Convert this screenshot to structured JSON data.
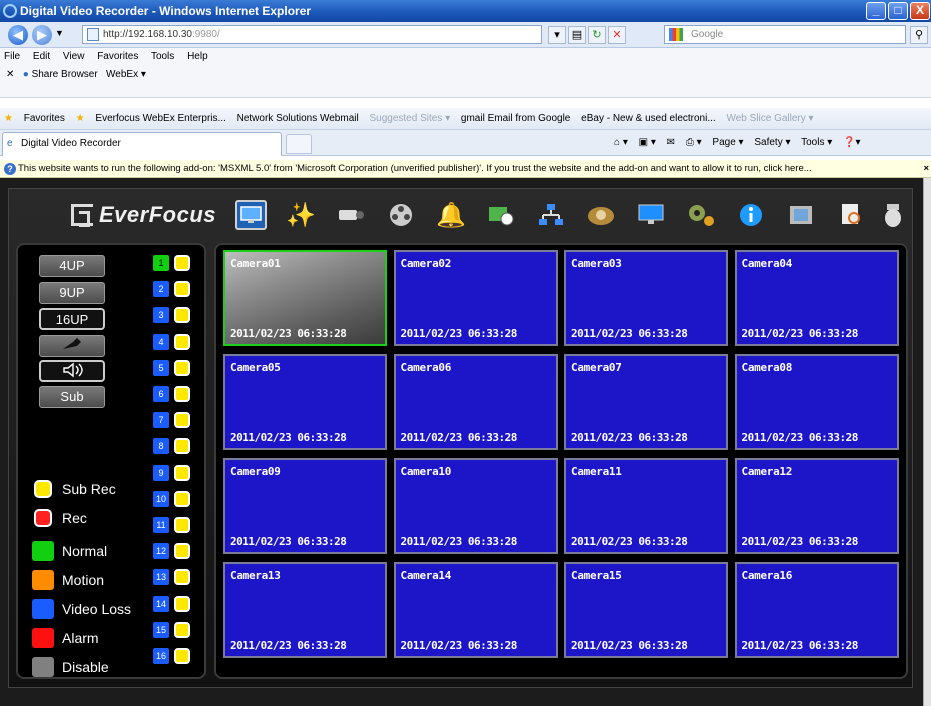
{
  "window": {
    "title": "Digital Video Recorder - Windows Internet Explorer",
    "minimize": "_",
    "maximize": "□",
    "close": "X"
  },
  "address_bar": {
    "url": "http://192.168.10.30",
    "port": ":9980/",
    "search_placeholder": "Google"
  },
  "menu": [
    "File",
    "Edit",
    "View",
    "Favorites",
    "Tools",
    "Help"
  ],
  "links": {
    "share_browser": "Share Browser",
    "webex": "WebEx ▾"
  },
  "favorites_bar": {
    "favorites_label": "Favorites",
    "items": [
      "Everfocus WebEx Enterpris...",
      "Network Solutions Webmail",
      "Suggested Sites ▾",
      "gmail Email from Google",
      "eBay - New & used electroni...",
      "Web Slice Gallery ▾"
    ]
  },
  "tab": {
    "title": "Digital Video Recorder"
  },
  "command_bar": [
    "Page ▾",
    "Safety ▾",
    "Tools ▾"
  ],
  "info_bar": {
    "message": "This website wants to run the following add-on: 'MSXML 5.0' from 'Microsoft Corporation (unverified publisher)'. If you trust the website and the add-on and want to allow it to run, click here...",
    "close": "×"
  },
  "dvr": {
    "brand": "EverFocus",
    "layout_buttons": [
      "4UP",
      "9UP",
      "16UP"
    ],
    "active_layout": "16UP",
    "sub_button": "Sub",
    "channels": [
      "1",
      "2",
      "3",
      "4",
      "5",
      "6",
      "7",
      "8",
      "9",
      "10",
      "11",
      "12",
      "13",
      "14",
      "15",
      "16"
    ],
    "legend": [
      {
        "label": "Sub Rec",
        "color": "#ffe800"
      },
      {
        "label": "Rec",
        "color": "#ff2020"
      },
      {
        "label": "Normal",
        "color": "#10d010"
      },
      {
        "label": "Motion",
        "color": "#ff8c00"
      },
      {
        "label": "Video Loss",
        "color": "#1b5cff"
      },
      {
        "label": "Alarm",
        "color": "#ff1010"
      },
      {
        "label": "Disable",
        "color": "#808080"
      }
    ],
    "cameras": [
      {
        "name": "Camera01",
        "timestamp": "2011/02/23  06:33:28"
      },
      {
        "name": "Camera02",
        "timestamp": "2011/02/23  06:33:28"
      },
      {
        "name": "Camera03",
        "timestamp": "2011/02/23  06:33:28"
      },
      {
        "name": "Camera04",
        "timestamp": "2011/02/23  06:33:28"
      },
      {
        "name": "Camera05",
        "timestamp": "2011/02/23  06:33:28"
      },
      {
        "name": "Camera06",
        "timestamp": "2011/02/23  06:33:28"
      },
      {
        "name": "Camera07",
        "timestamp": "2011/02/23  06:33:28"
      },
      {
        "name": "Camera08",
        "timestamp": "2011/02/23  06:33:28"
      },
      {
        "name": "Camera09",
        "timestamp": "2011/02/23  06:33:28"
      },
      {
        "name": "Camera10",
        "timestamp": "2011/02/23  06:33:28"
      },
      {
        "name": "Camera11",
        "timestamp": "2011/02/23  06:33:28"
      },
      {
        "name": "Camera12",
        "timestamp": "2011/02/23  06:33:28"
      },
      {
        "name": "Camera13",
        "timestamp": "2011/02/23  06:33:28"
      },
      {
        "name": "Camera14",
        "timestamp": "2011/02/23  06:33:28"
      },
      {
        "name": "Camera15",
        "timestamp": "2011/02/23  06:33:28"
      },
      {
        "name": "Camera16",
        "timestamp": "2011/02/23  06:33:28"
      }
    ],
    "toolbar_icons": [
      "live-view",
      "effects",
      "camera",
      "reel",
      "bell",
      "schedule",
      "network",
      "hdd",
      "monitor",
      "settings",
      "info",
      "film",
      "search",
      "ptz-dome"
    ]
  }
}
